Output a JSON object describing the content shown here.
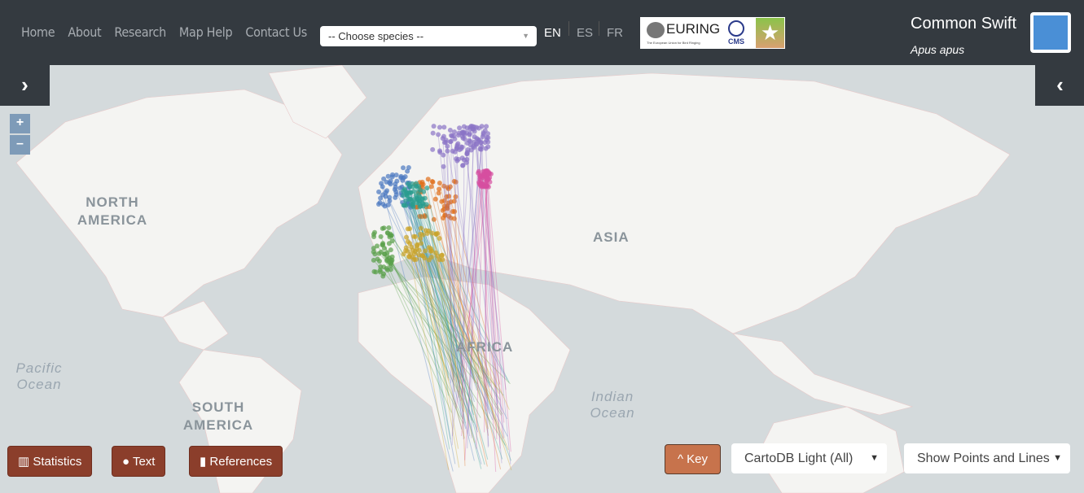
{
  "nav": {
    "items": [
      "Home",
      "About",
      "Research",
      "Map Help",
      "Contact Us"
    ]
  },
  "species_select": {
    "value": "-- Choose species --"
  },
  "languages": [
    "EN",
    "ES",
    "FR"
  ],
  "active_language": "EN",
  "logos": {
    "euring": "EURING",
    "euring_sub": "The European Union for Bird Ringing",
    "cms": "CMS"
  },
  "species": {
    "common": "Common Swift",
    "latin": "Apus apus"
  },
  "map": {
    "labels": {
      "north_america": "NORTH AMERICA",
      "asia": "ASIA",
      "africa": "AFRICA",
      "south_america": "SOUTH AMERICA",
      "pacific": "Pacific Ocean",
      "indian": "Indian Ocean"
    },
    "zoom_in": "+",
    "zoom_out": "–",
    "series_colors": [
      "#4a78c0",
      "#e06d1a",
      "#8a74c6",
      "#2a9d8f",
      "#5aa04a",
      "#d64fa0",
      "#c9a227"
    ]
  },
  "bottom": {
    "statistics": "Statistics",
    "text": "Text",
    "references": "References",
    "key": "Key",
    "basemap": "CartoDB Light (All)",
    "display": "Show Points and Lines"
  }
}
